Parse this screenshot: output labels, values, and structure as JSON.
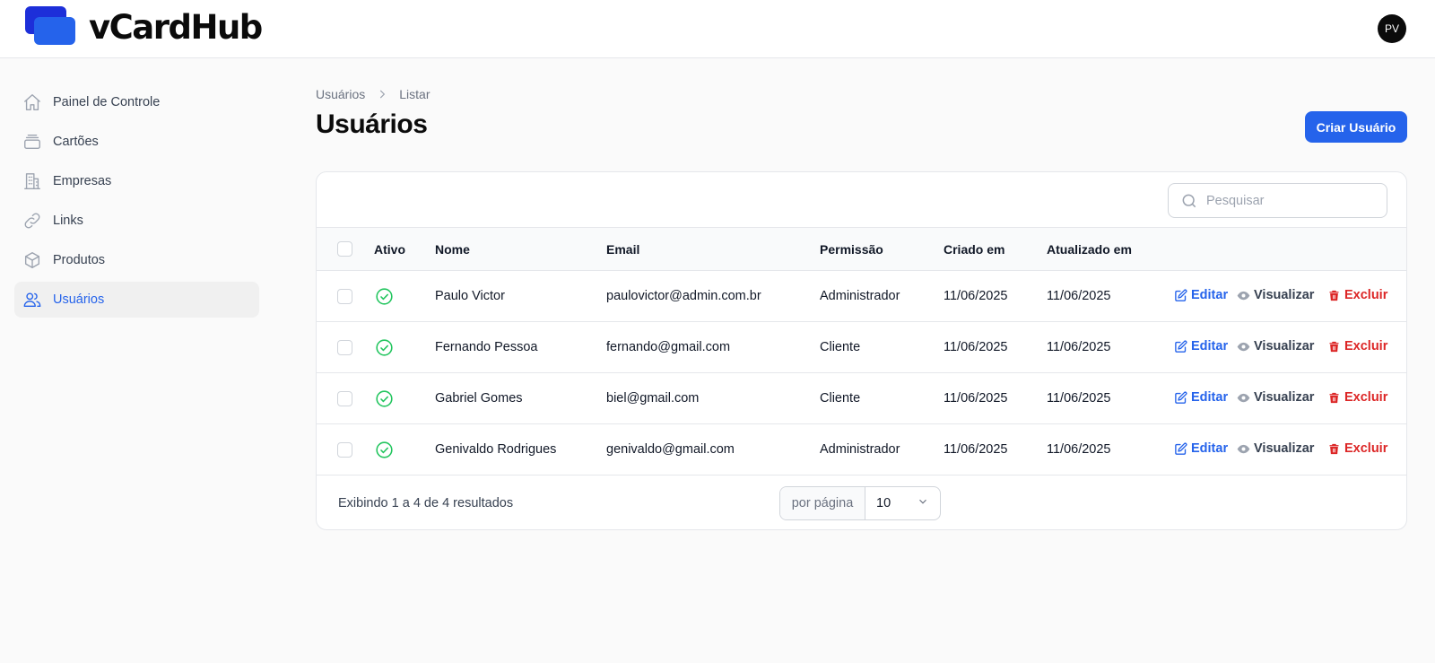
{
  "app": {
    "name": "vCardHub",
    "user_initials": "PV"
  },
  "sidebar": {
    "items": [
      {
        "label": "Painel de Controle",
        "icon": "home-icon",
        "active": false
      },
      {
        "label": "Cartões",
        "icon": "cards-stack-icon",
        "active": false
      },
      {
        "label": "Empresas",
        "icon": "building-icon",
        "active": false
      },
      {
        "label": "Links",
        "icon": "link-icon",
        "active": false
      },
      {
        "label": "Produtos",
        "icon": "cube-icon",
        "active": false
      },
      {
        "label": "Usuários",
        "icon": "users-icon",
        "active": true
      }
    ]
  },
  "breadcrumb": {
    "parent": "Usuários",
    "current": "Listar"
  },
  "page": {
    "title": "Usuários",
    "create_label": "Criar Usuário"
  },
  "search": {
    "placeholder": "Pesquisar",
    "value": ""
  },
  "table": {
    "columns": [
      "Ativo",
      "Nome",
      "Email",
      "Permissão",
      "Criado em",
      "Atualizado em"
    ],
    "rows": [
      {
        "active": true,
        "name": "Paulo Victor",
        "email": "paulovictor@admin.com.br",
        "role": "Administrador",
        "created": "11/06/2025",
        "updated": "11/06/2025"
      },
      {
        "active": true,
        "name": "Fernando Pessoa",
        "email": "fernando@gmail.com",
        "role": "Cliente",
        "created": "11/06/2025",
        "updated": "11/06/2025"
      },
      {
        "active": true,
        "name": "Gabriel Gomes",
        "email": "biel@gmail.com",
        "role": "Cliente",
        "created": "11/06/2025",
        "updated": "11/06/2025"
      },
      {
        "active": true,
        "name": "Genivaldo Rodrigues",
        "email": "genivaldo@gmail.com",
        "role": "Administrador",
        "created": "11/06/2025",
        "updated": "11/06/2025"
      }
    ],
    "actions": {
      "edit": "Editar",
      "view": "Visualizar",
      "delete": "Excluir"
    }
  },
  "pagination": {
    "summary": "Exibindo 1 a 4 de 4 resultados",
    "per_page_label": "por página",
    "per_page_value": "10"
  },
  "colors": {
    "accent": "#2563eb",
    "success": "#22c55e",
    "danger": "#dc2626",
    "logo_dark": "#1d2fd9",
    "logo_light": "#93c5fd"
  }
}
